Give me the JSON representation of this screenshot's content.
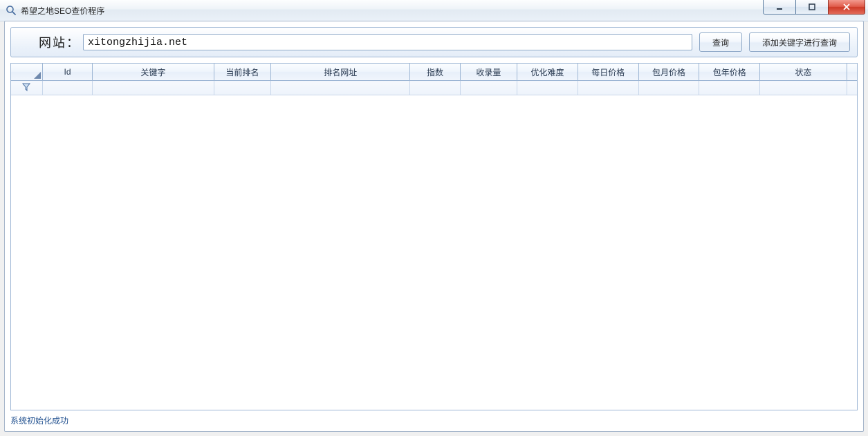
{
  "window": {
    "title": "希望之地SEO查价程序"
  },
  "search": {
    "label": "网站：",
    "value": "xitongzhijia.net",
    "query_btn": "查询",
    "addkw_btn": "添加关键字进行查询"
  },
  "grid": {
    "columns": [
      {
        "key": "id",
        "label": "Id",
        "width": 70
      },
      {
        "key": "keyword",
        "label": "关键字",
        "width": 170
      },
      {
        "key": "rank",
        "label": "当前排名",
        "width": 80
      },
      {
        "key": "rank_url",
        "label": "排名网址",
        "width": 195
      },
      {
        "key": "index",
        "label": "指数",
        "width": 70
      },
      {
        "key": "indexed",
        "label": "收录量",
        "width": 80
      },
      {
        "key": "difficulty",
        "label": "优化难度",
        "width": 85
      },
      {
        "key": "price_day",
        "label": "每日价格",
        "width": 85
      },
      {
        "key": "price_month",
        "label": "包月价格",
        "width": 85
      },
      {
        "key": "price_year",
        "label": "包年价格",
        "width": 85
      },
      {
        "key": "status",
        "label": "状态",
        "width": 122
      }
    ],
    "rows": []
  },
  "status": {
    "text": "系统初始化成功"
  }
}
